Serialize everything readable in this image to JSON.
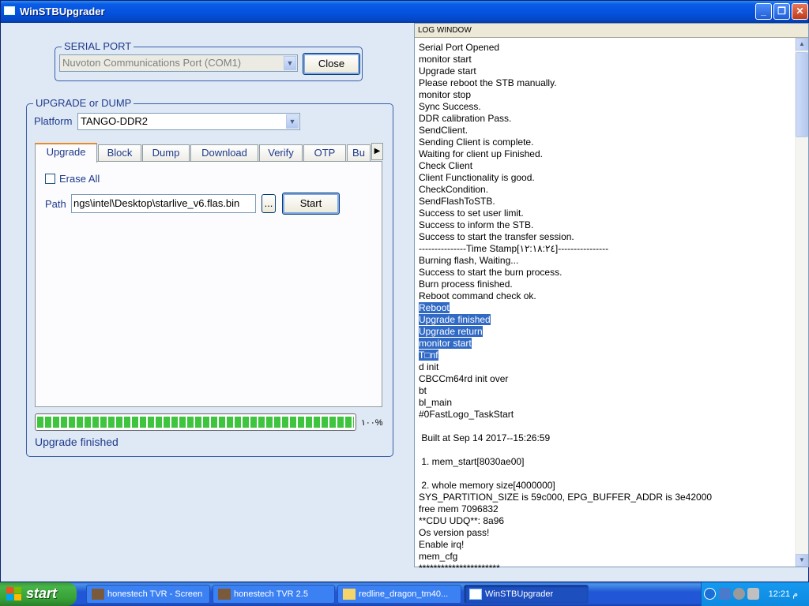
{
  "window": {
    "title": "WinSTBUpgrader",
    "min_icon": "minimize-icon",
    "max_icon": "restore-icon",
    "close_icon": "close-icon"
  },
  "serial_port": {
    "legend": "SERIAL PORT",
    "port_value": "Nuvoton Communications Port (COM1)",
    "close_button": "Close"
  },
  "upgrade": {
    "legend": "UPGRADE or DUMP",
    "platform_label": "Platform",
    "platform_value": "TANGO-DDR2",
    "tabs": [
      "Upgrade",
      "Block",
      "Dump",
      "Download",
      "Verify",
      "OTP",
      "Bu"
    ],
    "active_tab": "Upgrade",
    "erase_all_label": "Erase All",
    "erase_all_checked": false,
    "path_label": "Path",
    "path_value": "ngs\\intel\\Desktop\\starlive_v6.flas.bin",
    "browse_button": "...",
    "start_button": "Start",
    "progress_percent": 100,
    "progress_text": "١٠٠%",
    "status_text": "Upgrade finished"
  },
  "log": {
    "header": "LOG WINDOW",
    "lines": [
      "Serial Port Opened",
      "monitor start",
      "Upgrade start",
      "Please reboot the STB manually.",
      "monitor stop",
      "Sync Success.",
      "DDR calibration Pass.",
      "SendClient.",
      "Sending Client is complete.",
      "Waiting for client up Finished.",
      "Check Client",
      "Client Functionality is good.",
      "CheckCondition.",
      "SendFlashToSTB.",
      "Success to set user limit.",
      "Success to inform the STB.",
      "Success to start the transfer session.",
      "---------------Time Stamp[١٢:١٨:٢٤]----------------",
      "Burning flash, Waiting...",
      "Success to start the burn process.",
      "Burn process finished.",
      "Reboot command check ok.",
      "Reboot",
      "Upgrade finished",
      "Upgrade return",
      "monitor start",
      "T□nf",
      "d init",
      "CBCCm64rd init over",
      "bt",
      "bl_main",
      "#0FastLogo_TaskStart",
      "",
      " Built at Sep 14 2017--15:26:59",
      "",
      " 1. mem_start[8030ae00]",
      "",
      " 2. whole memory size[4000000]",
      "SYS_PARTITION_SIZE is 59c000, EPG_BUFFER_ADDR is 3e42000",
      "free mem 7096832",
      "**CDU UDQ**: 8a96",
      "Os version pass!",
      "Enable irq!",
      "mem_cfg",
      "**********************"
    ],
    "selected_lines": [
      22,
      23,
      24,
      25,
      26
    ]
  },
  "taskbar": {
    "start_label": "start",
    "tasks": [
      {
        "label": "honestech TVR - Screen",
        "icon": "tvr-icon",
        "active": false
      },
      {
        "label": "honestech TVR 2.5",
        "icon": "tvr-icon",
        "active": false
      },
      {
        "label": "redline_dragon_tm40...",
        "icon": "folder-icon",
        "active": false
      },
      {
        "label": "WinSTBUpgrader",
        "icon": "app-window-icon",
        "active": true
      }
    ],
    "clock": "12:21 م",
    "tray_icons": [
      "tray-arrow-icon",
      "network-icon",
      "speaker-icon",
      "settings-icon"
    ]
  },
  "colors": {
    "accent": "#316ac5",
    "progress": "#3ec43e",
    "titlebar": "#0553e0",
    "taskbar": "#2157d7"
  }
}
